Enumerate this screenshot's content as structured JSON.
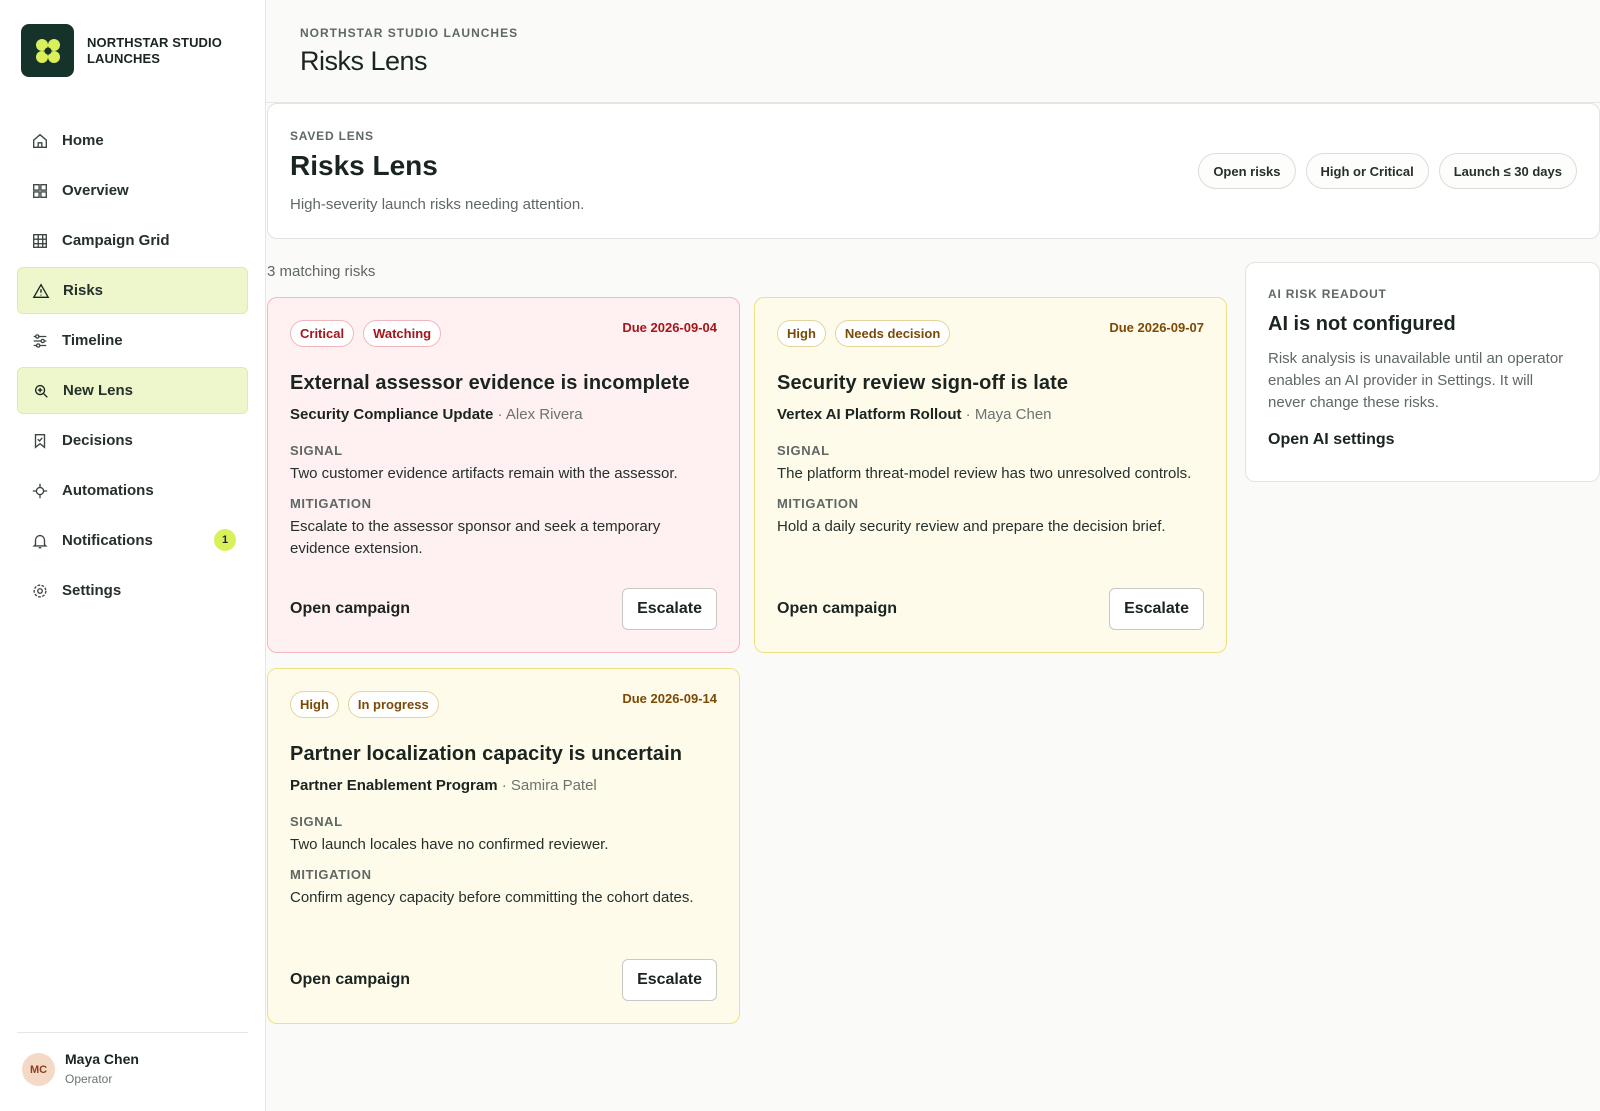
{
  "brand": {
    "name": "NORTHSTAR STUDIO LAUNCHES"
  },
  "nav": {
    "items": [
      {
        "label": "Home",
        "icon": "home-icon"
      },
      {
        "label": "Overview",
        "icon": "grid-icon"
      },
      {
        "label": "Campaign Grid",
        "icon": "table-icon"
      },
      {
        "label": "Risks",
        "icon": "warning-icon",
        "active": true
      },
      {
        "label": "Timeline",
        "icon": "sliders-icon"
      },
      {
        "label": "New Lens",
        "icon": "lens-icon",
        "active": true
      },
      {
        "label": "Decisions",
        "icon": "bookmark-check-icon"
      },
      {
        "label": "Automations",
        "icon": "crosshair-icon"
      },
      {
        "label": "Notifications",
        "icon": "bell-icon",
        "badge": "1"
      },
      {
        "label": "Settings",
        "icon": "gear-icon"
      }
    ]
  },
  "user": {
    "initials": "MC",
    "name": "Maya Chen",
    "role": "Operator"
  },
  "header": {
    "eyebrow": "NORTHSTAR STUDIO LAUNCHES",
    "title": "Risks Lens"
  },
  "lens": {
    "eyebrow": "SAVED LENS",
    "title": "Risks Lens",
    "description": "High-severity launch risks needing attention.",
    "chips": [
      "Open risks",
      "High or Critical",
      "Launch ≤ 30 days"
    ]
  },
  "results": {
    "count_label": "3 matching risks"
  },
  "risks": [
    {
      "severity": "Critical",
      "status": "Watching",
      "due": "Due 2026-09-04",
      "title": "External assessor evidence is incomplete",
      "campaign": "Security Compliance Update",
      "owner": " · Alex Rivera",
      "signal_label": "SIGNAL",
      "signal": "Two customer evidence artifacts remain with the assessor.",
      "mitigation_label": "MITIGATION",
      "mitigation": "Escalate to the assessor sponsor and seek a temporary evidence extension.",
      "open_label": "Open campaign",
      "escalate_label": "Escalate"
    },
    {
      "severity": "High",
      "status": "Needs decision",
      "due": "Due 2026-09-07",
      "title": "Security review sign-off is late",
      "campaign": "Vertex AI Platform Rollout",
      "owner": " · Maya Chen",
      "signal_label": "SIGNAL",
      "signal": "The platform threat-model review has two unresolved controls.",
      "mitigation_label": "MITIGATION",
      "mitigation": "Hold a daily security review and prepare the decision brief.",
      "open_label": "Open campaign",
      "escalate_label": "Escalate"
    },
    {
      "severity": "High",
      "status": "In progress",
      "due": "Due 2026-09-14",
      "title": "Partner localization capacity is uncertain",
      "campaign": "Partner Enablement Program",
      "owner": " · Samira Patel",
      "signal_label": "SIGNAL",
      "signal": "Two launch locales have no confirmed reviewer.",
      "mitigation_label": "MITIGATION",
      "mitigation": "Confirm agency capacity before committing the cohort dates.",
      "open_label": "Open campaign",
      "escalate_label": "Escalate"
    }
  ],
  "ai": {
    "eyebrow": "AI RISK READOUT",
    "title": "AI is not configured",
    "text": "Risk analysis is unavailable until an operator enables an AI provider in Settings. It will never change these risks.",
    "link": "Open AI settings"
  },
  "colors": {
    "accent": "#d9f05a",
    "active_nav": "#eef7cc",
    "critical_bg": "#fff0f2",
    "high_bg": "#fffbea",
    "brand_dark": "#16332b"
  }
}
